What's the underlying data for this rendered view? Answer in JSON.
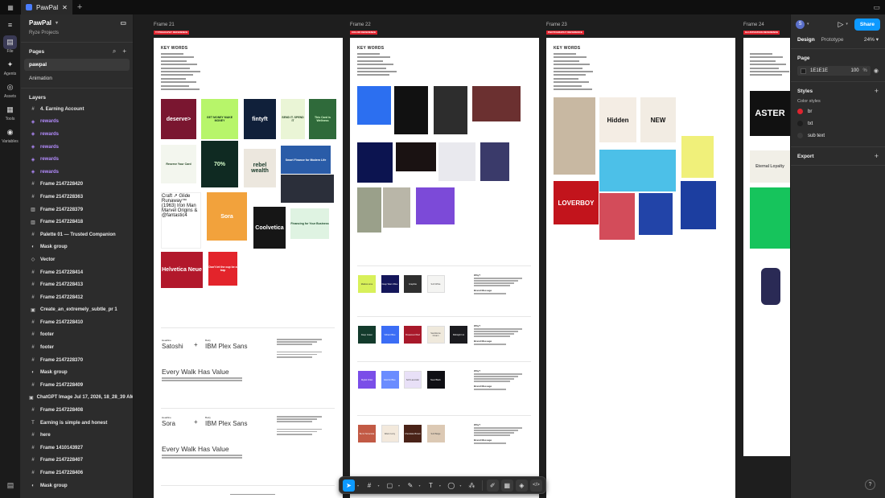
{
  "tabbar": {
    "tab_label": "PawPal",
    "close": "✕",
    "plus": "+"
  },
  "rail": [
    {
      "label": "",
      "icon": "figma-menu-icon",
      "glyph": "≡"
    },
    {
      "label": "File",
      "icon": "file-icon",
      "glyph": "▤",
      "active": true
    },
    {
      "label": "Agents",
      "icon": "agents-icon",
      "glyph": "✦"
    },
    {
      "label": "Assets",
      "icon": "assets-icon",
      "glyph": "◎"
    },
    {
      "label": "Tools",
      "icon": "tools-icon",
      "glyph": "▦"
    },
    {
      "label": "Variables",
      "icon": "variables-icon",
      "glyph": "◉"
    }
  ],
  "file": {
    "name": "PawPal",
    "project": "Ryze Projects"
  },
  "pages": {
    "heading": "Pages",
    "items": [
      {
        "label": "pawpal",
        "active": true
      },
      {
        "label": "Animation",
        "active": false
      }
    ]
  },
  "layers": {
    "heading": "Layers",
    "items": [
      {
        "label": "4. Earning Account",
        "icon": "frame",
        "comp": false
      },
      {
        "label": "rewards",
        "icon": "comp",
        "comp": true
      },
      {
        "label": "rewards",
        "icon": "comp",
        "comp": true
      },
      {
        "label": "rewards",
        "icon": "comp",
        "comp": true
      },
      {
        "label": "rewards",
        "icon": "comp",
        "comp": true
      },
      {
        "label": "rewards",
        "icon": "comp",
        "comp": true
      },
      {
        "label": "Frame 2147228420",
        "icon": "frame",
        "comp": false
      },
      {
        "label": "Frame 2147228363",
        "icon": "frame",
        "comp": false
      },
      {
        "label": "Frame 2147228379",
        "icon": "grid",
        "comp": false
      },
      {
        "label": "Frame 2147228418",
        "icon": "grid",
        "comp": false
      },
      {
        "label": "Palette 01 — Trusted Companion",
        "icon": "frame",
        "comp": false
      },
      {
        "label": "Mask group",
        "icon": "mask",
        "comp": false
      },
      {
        "label": "Vector",
        "icon": "vector",
        "comp": false
      },
      {
        "label": "Frame 2147228414",
        "icon": "frame",
        "comp": false
      },
      {
        "label": "Frame 2147228413",
        "icon": "frame",
        "comp": false
      },
      {
        "label": "Frame 2147228412",
        "icon": "frame",
        "comp": false
      },
      {
        "label": "Create_an_extremely_subtle_pr 1",
        "icon": "image",
        "comp": false
      },
      {
        "label": "Frame 2147228410",
        "icon": "frame",
        "comp": false
      },
      {
        "label": "footer",
        "icon": "frame",
        "comp": false
      },
      {
        "label": "footer",
        "icon": "frame",
        "comp": false
      },
      {
        "label": "Frame 2147228370",
        "icon": "frame",
        "comp": false
      },
      {
        "label": "Mask group",
        "icon": "mask",
        "comp": false
      },
      {
        "label": "Frame 2147228409",
        "icon": "frame",
        "comp": false
      },
      {
        "label": "ChatGPT Image Jul 17, 2026, 18_28_39 AM 3",
        "icon": "image",
        "comp": false
      },
      {
        "label": "Frame 2147228408",
        "icon": "frame",
        "comp": false
      },
      {
        "label": "Earning is simple and honest",
        "icon": "text",
        "comp": false
      },
      {
        "label": "here",
        "icon": "frame",
        "comp": false
      },
      {
        "label": "Frame 1410143927",
        "icon": "frame",
        "comp": false
      },
      {
        "label": "Frame 2147228407",
        "icon": "frame",
        "comp": false
      },
      {
        "label": "Frame 2147228406",
        "icon": "frame",
        "comp": false
      },
      {
        "label": "Mask group",
        "icon": "mask",
        "comp": false
      }
    ]
  },
  "canvas": {
    "frames": [
      {
        "label": "Frame 21",
        "tag": "TYPOGRAPHY REFERENCE"
      },
      {
        "label": "Frame 22",
        "tag": "COLOR REFERENCE"
      },
      {
        "label": "Frame 23",
        "tag": "PHOTOGRAPHY REFERENCE"
      },
      {
        "label": "Frame 24",
        "tag": "ILLUSTRATION REFERENCE"
      }
    ],
    "key_words": "KEY WORDS",
    "f21_tiles": [
      {
        "text": "deserve>",
        "bg": "#7a1630",
        "fg": "#ffffff"
      },
      {
        "text": "GET MONEY MAKE MONEY",
        "bg": "#b7f56a",
        "fg": "#10301a"
      },
      {
        "text": "fintyft",
        "bg": "#10203a",
        "fg": "#ffffff"
      },
      {
        "text": "SEND IT. SPEND IT",
        "bg": "#eaf5d6",
        "fg": "#1a3a1a"
      },
      {
        "text": "This Card is Wellness",
        "bg": "#2f6a3a",
        "fg": "#d8ffcc"
      },
      {
        "text": "Reserve Your Card",
        "bg": "#f3f6ee",
        "fg": "#1a3d1a"
      },
      {
        "text": "70%",
        "bg": "#0f2a22",
        "fg": "#d7ffcc"
      },
      {
        "text": "rebel wealth",
        "bg": "#ece7de",
        "fg": "#1a3a2a"
      },
      {
        "text": "Smart Finance for Modern Life",
        "bg": "#2a5ca8",
        "fg": "#ffffff"
      },
      {
        "text": "",
        "bg": "#2b2f3a",
        "fg": "#ffffff"
      },
      {
        "text": "Craft ↗ Glide Runaway™ (1963) Iron Man Marvel Origins & @fantastic4",
        "bg": "#ffffff",
        "fg": "#111111"
      },
      {
        "text": "Sora",
        "bg": "#f2a23c",
        "fg": "#ffffff"
      },
      {
        "text": "Coolvetica",
        "bg": "#161616",
        "fg": "#ffffff"
      },
      {
        "text": "Financing for Your Business",
        "bg": "#dff3e2",
        "fg": "#1a4a2a"
      },
      {
        "text": "Helvetica Neue",
        "bg": "#b2182b",
        "fg": "#ffffff"
      },
      {
        "text": "Don't let the cup be a trap",
        "bg": "#e3242b",
        "fg": "#ffffff"
      }
    ],
    "typo_rows": [
      {
        "headline_label": "Headline",
        "headline_font": "Satoshi",
        "body_label": "Body",
        "body_font": "IBM Plex Sans",
        "sample": "Every Walk Has Value"
      },
      {
        "headline_label": "Headline",
        "headline_font": "Sora",
        "body_label": "Body",
        "body_font": "IBM Plex Sans",
        "sample": "Every Walk Has Value"
      }
    ],
    "color_rows": [
      {
        "swatches": [
          {
            "name": "Mellow Lime",
            "bg": "#d8f05a",
            "fg": "#2a2a2a"
          },
          {
            "name": "Deep Warm Blue",
            "bg": "#14165a",
            "fg": "#ffffff"
          },
          {
            "name": "Graphite",
            "bg": "#2f2f2f",
            "fg": "#ffffff"
          },
          {
            "name": "Soft White",
            "bg": "#f4f4f2",
            "fg": "#444444"
          }
        ],
        "brand_message": "Brand Message",
        "why": "Why?"
      },
      {
        "swatches": [
          {
            "name": "Deep Green",
            "bg": "#133b2c",
            "fg": "#ffffff"
          },
          {
            "name": "Vibrant Blue",
            "bg": "#3b6df5",
            "fg": "#ffffff"
          },
          {
            "name": "Rosewood Red",
            "bg": "#a8192a",
            "fg": "#ffffff"
          },
          {
            "name": "Sandstone Cream",
            "bg": "#efe9dc",
            "fg": "#444444"
          },
          {
            "name": "Midnight Ink",
            "bg": "#1b1b1f",
            "fg": "#ffffff"
          }
        ],
        "brand_message": "Brand Message",
        "why": "Why?"
      },
      {
        "swatches": [
          {
            "name": "Digital Violet",
            "bg": "#7a4ee8",
            "fg": "#ffffff"
          },
          {
            "name": "Electric Blue",
            "bg": "#6a8cff",
            "fg": "#ffffff"
          },
          {
            "name": "Soft Lavender",
            "bg": "#e8e0f7",
            "fg": "#444444"
          },
          {
            "name": "Near Black",
            "bg": "#0f0f14",
            "fg": "#ffffff"
          }
        ],
        "brand_message": "Brand Message",
        "why": "Why?"
      },
      {
        "swatches": [
          {
            "name": "Burnt Terracotta",
            "bg": "#c25a45",
            "fg": "#ffffff"
          },
          {
            "name": "Warm Ivory",
            "bg": "#f3e9dc",
            "fg": "#444444"
          },
          {
            "name": "Chocolate Brown",
            "bg": "#4a2318",
            "fg": "#ffffff"
          },
          {
            "name": "Soft Beige",
            "bg": "#dcc9b4",
            "fg": "#444444"
          }
        ],
        "brand_message": "Brand Message",
        "why": "Why?"
      }
    ],
    "f23_tiles": [
      {
        "text": "",
        "bg": "#c8b8a2"
      },
      {
        "text": "Hidden",
        "bg": "#f4ede4"
      },
      {
        "text": "NEW",
        "bg": "#f2ece3"
      },
      {
        "text": "",
        "bg": "#4cc0e8"
      },
      {
        "text": "",
        "bg": "#f0f07a"
      },
      {
        "text": "LOVERBOY",
        "bg": "#c2141c"
      },
      {
        "text": "",
        "bg": "#d34c5a"
      },
      {
        "text": "",
        "bg": "#2244a8"
      },
      {
        "text": "",
        "bg": "#1c3ea0"
      }
    ],
    "f24_tiles": [
      {
        "text": "ASTER",
        "bg": "#111111"
      },
      {
        "text": "Eternal Loyalty",
        "bg": "#f1efe7"
      },
      {
        "text": "",
        "bg": "#16c45c"
      },
      {
        "text": "",
        "bg": "#ffffff"
      }
    ]
  },
  "rightpanel": {
    "avatar": "S",
    "share": "Share",
    "tabs": {
      "design": "Design",
      "prototype": "Prototype",
      "zoom": "24%"
    },
    "page": {
      "heading": "Page",
      "hex": "1E1E1E",
      "opacity": "100",
      "unit": "%"
    },
    "styles": {
      "heading": "Styles",
      "sub": "Color styles",
      "items": [
        {
          "name": "br",
          "color": "#e0242f"
        },
        {
          "name": "txt",
          "color": "#1e1e1e"
        },
        {
          "name": "sub text",
          "color": "#3a3a3a"
        }
      ]
    },
    "export": {
      "heading": "Export"
    },
    "help": "?"
  },
  "toolbar": {
    "tools": [
      {
        "name": "move-tool",
        "glyph": "➤",
        "active": true,
        "caret": true
      },
      {
        "name": "frame-tool",
        "glyph": "#",
        "caret": true
      },
      {
        "name": "shape-tool",
        "glyph": "▢",
        "caret": true
      },
      {
        "name": "pen-tool",
        "glyph": "✎",
        "caret": true
      },
      {
        "name": "text-tool",
        "glyph": "T",
        "caret": true
      },
      {
        "name": "comment-tool",
        "glyph": "◯",
        "caret": true
      },
      {
        "name": "actions-tool",
        "glyph": "⁂",
        "caret": false
      },
      {
        "name": "draw-tool",
        "glyph": "✐",
        "pill": true
      },
      {
        "name": "grid-tool",
        "glyph": "▦",
        "pill": true,
        "active2": true
      },
      {
        "name": "component-tool",
        "glyph": "◈",
        "pill": true
      },
      {
        "name": "code-tool",
        "glyph": "</>",
        "pill": true
      }
    ]
  },
  "colors": {
    "accent": "#0d99ff",
    "tag_red": "#e0242f",
    "component_purple": "#b48cff"
  }
}
